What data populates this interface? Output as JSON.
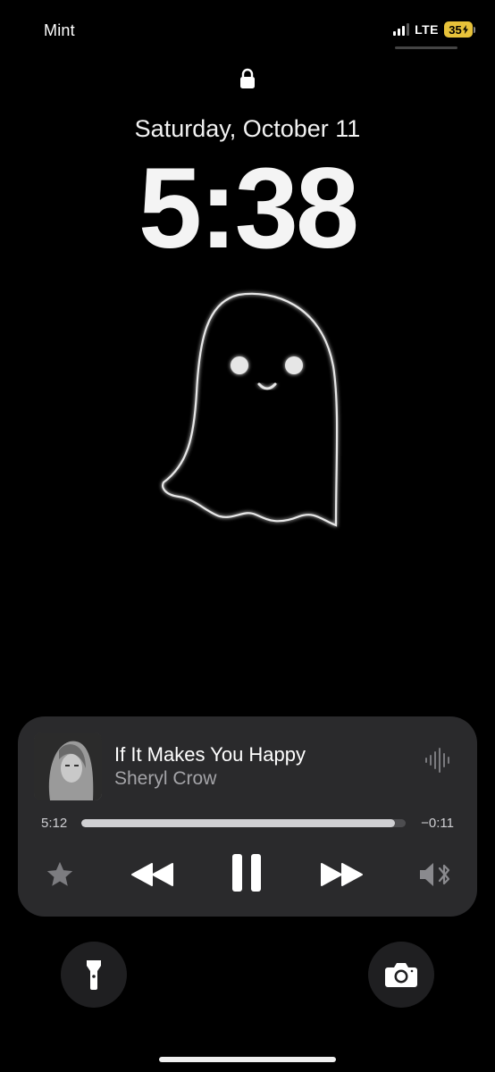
{
  "status_bar": {
    "carrier": "Mint",
    "network": "LTE",
    "battery_percent": "35",
    "signal_bars_active": 3,
    "signal_bars_total": 4
  },
  "lock_screen": {
    "date": "Saturday, October 11",
    "time": "5:38",
    "wallpaper": "ghost-outline"
  },
  "now_playing": {
    "title": "If It Makes You Happy",
    "artist": "Sheryl Crow",
    "elapsed": "5:12",
    "remaining": "−0:11",
    "progress_fraction": 0.966,
    "icons": {
      "favorite": "star-icon",
      "previous": "rewind-icon",
      "playpause": "pause-icon",
      "next": "fast-forward-icon",
      "output": "speaker-bluetooth-icon",
      "visualizer": "waveform-icon"
    }
  },
  "quick_actions": {
    "left": "flashlight-icon",
    "right": "camera-icon"
  },
  "colors": {
    "background": "#000000",
    "player_bg": "#2a2a2c",
    "battery": "#e7c23a",
    "secondary_text": "#a4a4a8"
  }
}
